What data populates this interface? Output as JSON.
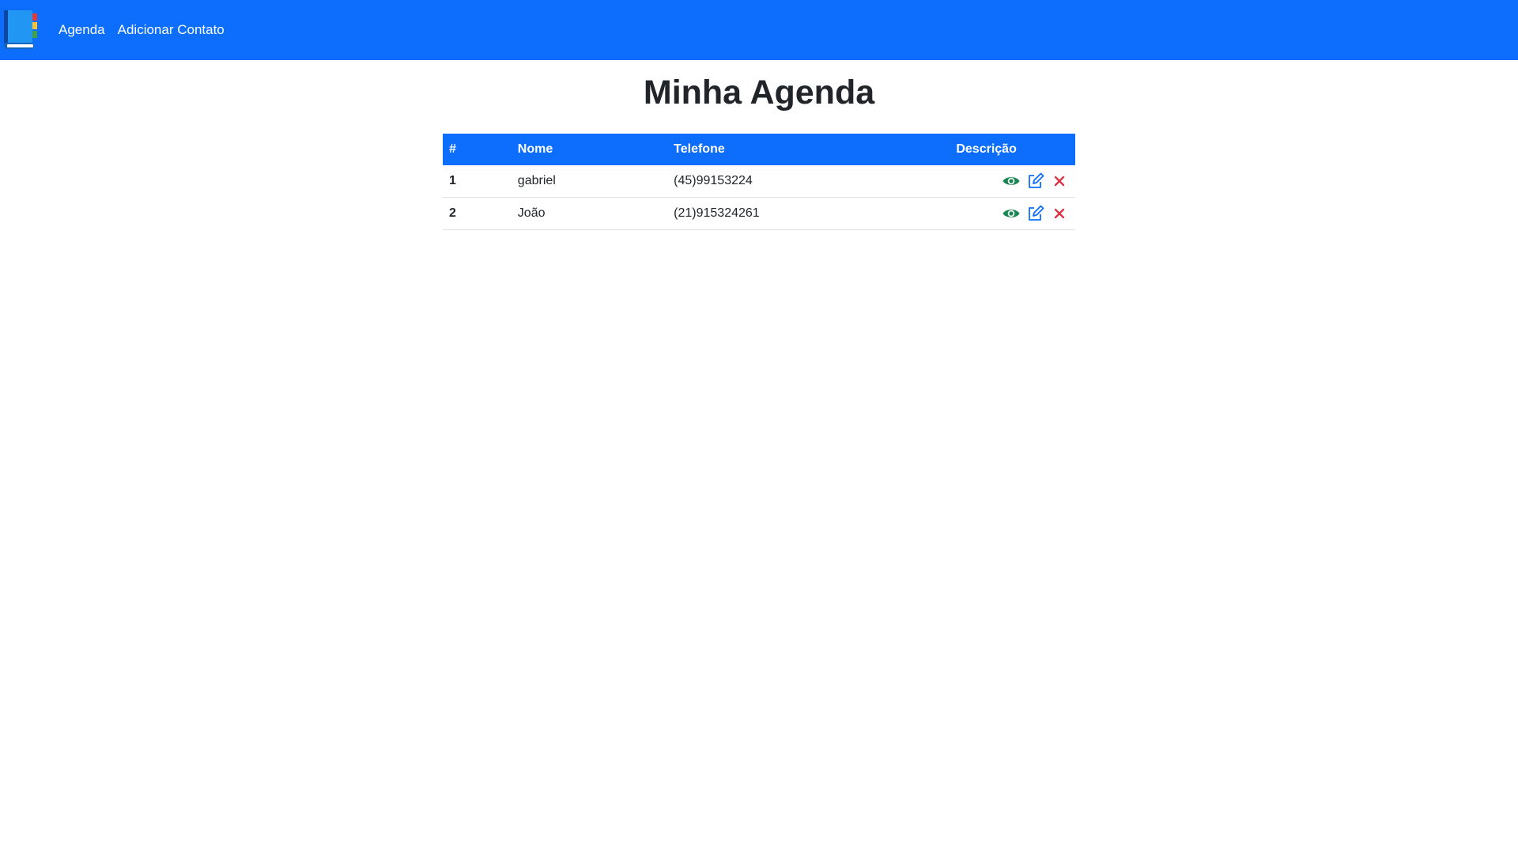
{
  "navbar": {
    "brand_icon": "address-book-icon",
    "links": [
      {
        "label": "Agenda"
      },
      {
        "label": "Adicionar Contato"
      }
    ],
    "background": "#0d6efd"
  },
  "page": {
    "title": "Minha Agenda"
  },
  "table": {
    "headers": [
      "#",
      "Nome",
      "Telefone",
      "Descrição"
    ],
    "rows": [
      {
        "index": "1",
        "nome": "gabriel",
        "telefone": "(45)99153224"
      },
      {
        "index": "2",
        "nome": "João",
        "telefone": "(21)915324261"
      }
    ],
    "row_actions": [
      "view-icon",
      "edit-icon",
      "delete-icon"
    ],
    "colors": {
      "header": "#0d6efd",
      "view": "#198754",
      "edit": "#0d6efd",
      "delete": "#dc3545"
    }
  }
}
